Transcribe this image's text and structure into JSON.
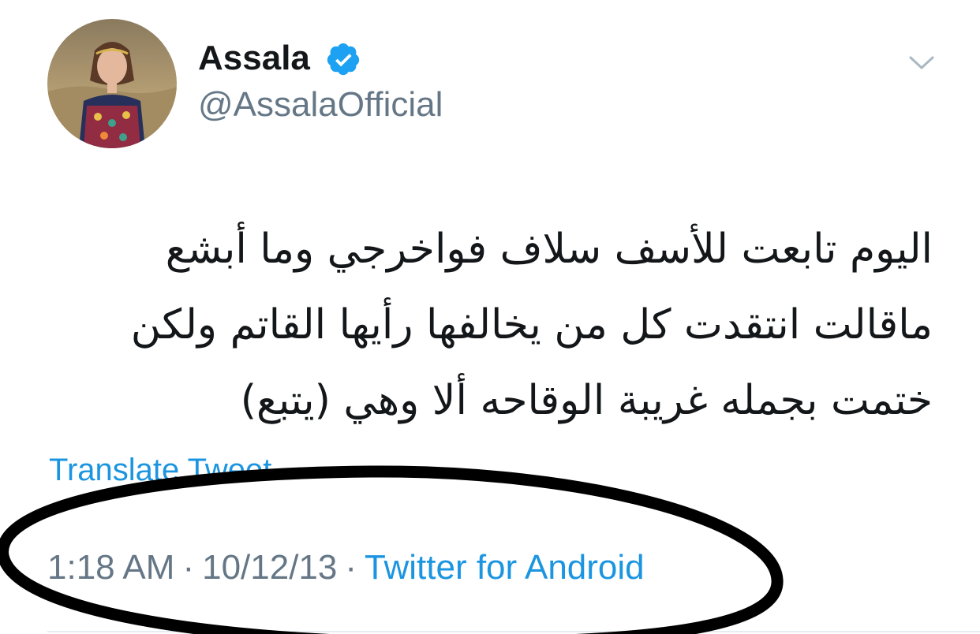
{
  "author": {
    "display_name": "Assala",
    "handle": "@AssalaOfficial",
    "verified": true
  },
  "tweet": {
    "lines": [
      "اليوم تابعت للأسف سلاف فواخرجي وما أبشع",
      "ماقالت انتقدت كل من يخالفها رأيها القاتم ولكن",
      "ختمت بجمله غريبة الوقاحه ألا وهي (يتبع)"
    ],
    "translate_label": "Translate Tweet"
  },
  "meta": {
    "time": "1:18 AM",
    "separator": "·",
    "date": "10/12/13",
    "source": "Twitter for Android"
  },
  "icons": {
    "verified": "verified-badge-icon",
    "menu": "chevron-down-icon"
  },
  "colors": {
    "text": "#14171a",
    "secondary": "#657786",
    "link": "#1b95e0",
    "verified": "#1da1f2",
    "annotation": "#000000"
  }
}
